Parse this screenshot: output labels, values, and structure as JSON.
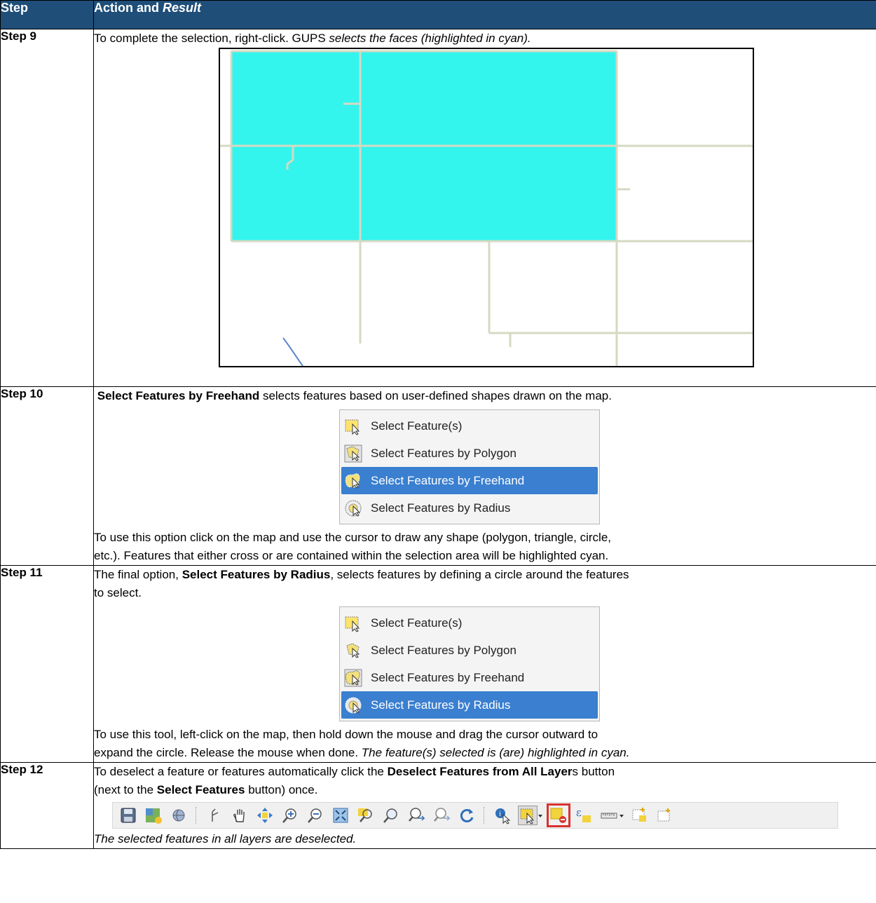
{
  "header": {
    "step": "Step",
    "action_plain": "Action and ",
    "action_italic": "Result"
  },
  "step9": {
    "label": "Step 9",
    "text_plain": "To complete the selection, right-click. GUPS ",
    "text_italic": "selects the faces (highlighted in cyan)."
  },
  "step10": {
    "label": "Step 10",
    "bold": "Select Features by Freehand",
    "text": " selects features based on user-defined shapes drawn on the map.",
    "menu": [
      "Select Feature(s)",
      "Select Features by Polygon",
      "Select Features by Freehand",
      "Select Features by Radius"
    ],
    "active_index": 2,
    "after_line1": "To use this option click on the map and use the cursor to draw any shape (polygon, triangle, circle,",
    "after_line2": "etc.). Features that either cross or are contained within the selection area will be highlighted cyan."
  },
  "step11": {
    "label": "Step 11",
    "intro_plain": "The final option, ",
    "intro_bold": "Select Features by Radius",
    "intro_rest1": ", selects features by defining a circle around the features",
    "intro_rest2": "to select.",
    "menu": [
      "Select Feature(s)",
      "Select Features by Polygon",
      "Select Features by Freehand",
      "Select Features by Radius"
    ],
    "active_index": 3,
    "after_line1": "To use this tool, left-click on the map, then hold down the mouse and drag the cursor outward to",
    "after_line2_plain": "expand the circle. Release the mouse when done. ",
    "after_line2_italic": "The feature(s) selected is (are) highlighted in cyan."
  },
  "step12": {
    "label": "Step 12",
    "l1_plain": "To deselect a feature or features automatically click the ",
    "l1_bold": "Deselect Features from All Layer",
    "l1_rest": "s button",
    "l2_plain": "(next to the ",
    "l2_bold": "Select Features",
    "l2_rest": " button) once.",
    "result_italic": "The selected features in all layers are deselected."
  },
  "colors": {
    "header_bg": "#1f4e79",
    "cyan": "#33f5ee",
    "menu_active": "#3a7fd0",
    "highlight": "#d9322e"
  },
  "toolbar_icons": [
    "save-icon",
    "new-map-icon",
    "globe-icon",
    "touch-icon",
    "pan-hand-icon",
    "pan-to-selection-icon",
    "zoom-in-icon",
    "zoom-out-icon",
    "zoom-full-icon",
    "zoom-to-selection-icon",
    "zoom-to-layer-icon",
    "zoom-last-icon",
    "zoom-next-icon",
    "refresh-icon",
    "identify-icon",
    "select-features-icon",
    "deselect-all-icon",
    "select-by-expression-icon",
    "measure-icon",
    "new-bookmark-icon",
    "show-bookmarks-icon"
  ]
}
